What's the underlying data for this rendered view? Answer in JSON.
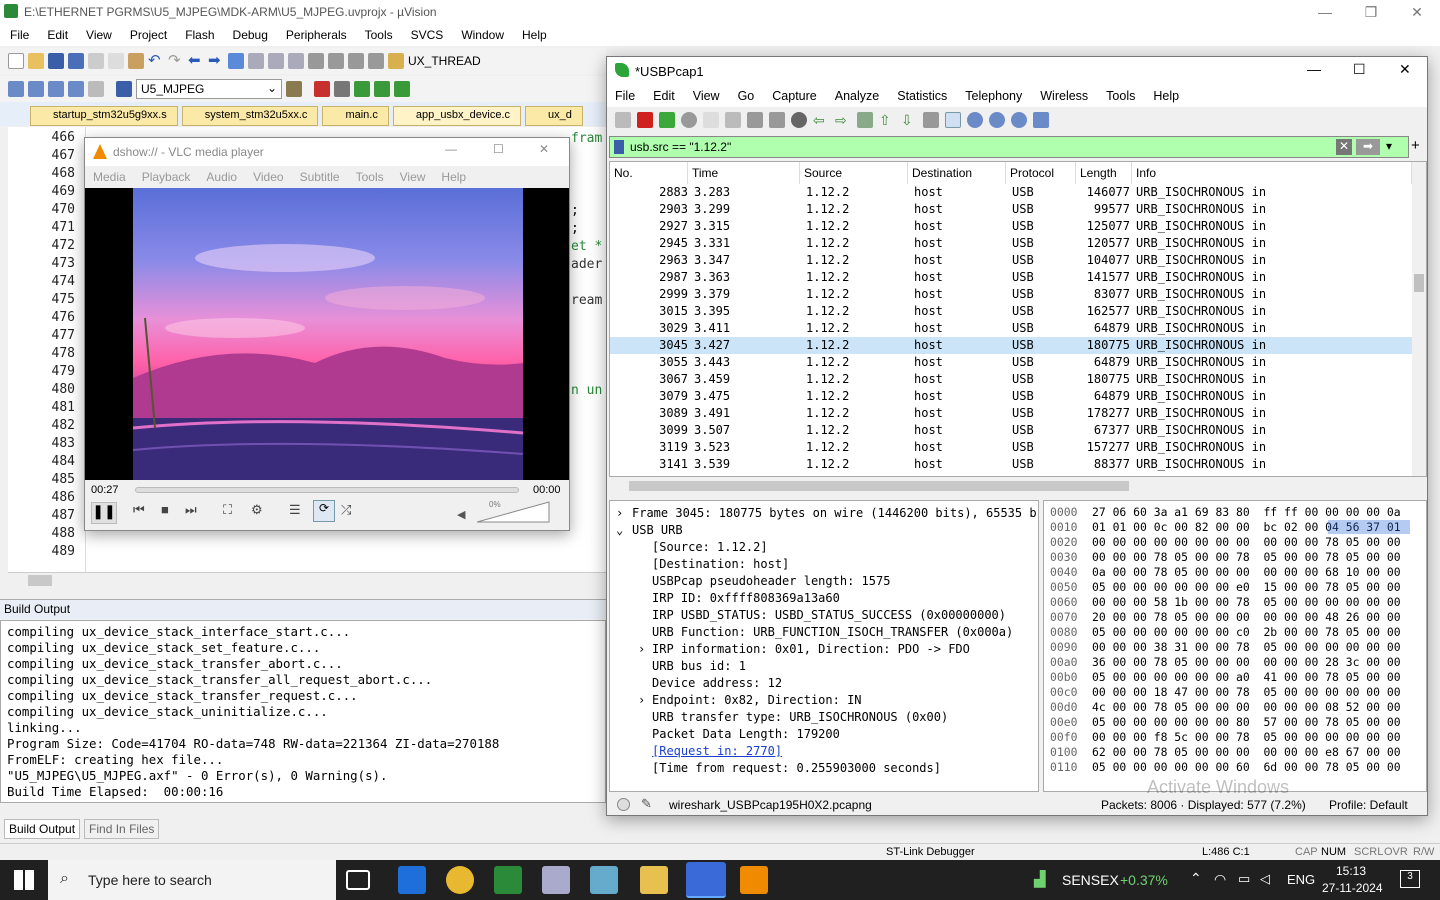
{
  "uvision": {
    "title": "E:\\ETHERNET PGRMS\\U5_MJPEG\\MDK-ARM\\U5_MJPEG.uvprojx - µVision",
    "menu": [
      "File",
      "Edit",
      "View",
      "Project",
      "Flash",
      "Debug",
      "Peripherals",
      "Tools",
      "SVCS",
      "Window",
      "Help"
    ],
    "thread_box": "UX_THREAD",
    "target": "U5_MJPEG",
    "tabs": [
      "startup_stm32u5g9xx.s",
      "system_stm32u5xx.c",
      "main.c",
      "app_usbx_device.c",
      "ux_d"
    ],
    "line_numbers": [
      "466",
      "467",
      "468",
      "469",
      "470",
      "471",
      "472",
      "473",
      "474",
      "475",
      "476",
      "477",
      "478",
      "479",
      "480",
      "481",
      "482",
      "483",
      "484",
      "485",
      "486",
      "487",
      "488",
      "489"
    ],
    "code_fragments": [
      "fram",
      ";",
      ";",
      "et *",
      "ader",
      "ream",
      "n un"
    ],
    "build_output_title": "Build Output",
    "build_lines": [
      "compiling ux_device_stack_interface_start.c...",
      "compiling ux_device_stack_set_feature.c...",
      "compiling ux_device_stack_transfer_abort.c...",
      "compiling ux_device_stack_transfer_all_request_abort.c...",
      "compiling ux_device_stack_transfer_request.c...",
      "compiling ux_device_stack_uninitialize.c...",
      "linking...",
      "Program Size: Code=41704 RO-data=748 RW-data=221364 ZI-data=270188",
      "FromELF: creating hex file...",
      "\"U5_MJPEG\\U5_MJPEG.axf\" - 0 Error(s), 0 Warning(s).",
      "Build Time Elapsed:  00:00:16"
    ],
    "bottom_tabs": [
      "Build Output",
      "Find In Files"
    ],
    "status": {
      "debugger": "ST-Link Debugger",
      "position": "L:486 C:1",
      "caps": "CAP",
      "num": "NUM",
      "scrl": "SCRL",
      "ovr": "OVR",
      "rw": "R/W"
    }
  },
  "vlc": {
    "title": "dshow:// - VLC media player",
    "menu": [
      "Media",
      "Playback",
      "Audio",
      "Video",
      "Subtitle",
      "Tools",
      "View",
      "Help"
    ],
    "elapsed": "00:27",
    "remaining": "00:00",
    "volume": "0%"
  },
  "wireshark": {
    "title": "*USBPcap1",
    "menu": [
      "File",
      "Edit",
      "View",
      "Go",
      "Capture",
      "Analyze",
      "Statistics",
      "Telephony",
      "Wireless",
      "Tools",
      "Help"
    ],
    "filter": "usb.src == \"1.12.2\"",
    "columns": [
      "No.",
      "Time",
      "Source",
      "Destination",
      "Protocol",
      "Length",
      "Info"
    ],
    "packets": [
      {
        "no": "2883",
        "time": "3.283",
        "src": "1.12.2",
        "dst": "host",
        "proto": "USB",
        "len": "146077",
        "info": "URB_ISOCHRONOUS in"
      },
      {
        "no": "2903",
        "time": "3.299",
        "src": "1.12.2",
        "dst": "host",
        "proto": "USB",
        "len": "99577",
        "info": "URB_ISOCHRONOUS in"
      },
      {
        "no": "2927",
        "time": "3.315",
        "src": "1.12.2",
        "dst": "host",
        "proto": "USB",
        "len": "125077",
        "info": "URB_ISOCHRONOUS in"
      },
      {
        "no": "2945",
        "time": "3.331",
        "src": "1.12.2",
        "dst": "host",
        "proto": "USB",
        "len": "120577",
        "info": "URB_ISOCHRONOUS in"
      },
      {
        "no": "2963",
        "time": "3.347",
        "src": "1.12.2",
        "dst": "host",
        "proto": "USB",
        "len": "104077",
        "info": "URB_ISOCHRONOUS in"
      },
      {
        "no": "2987",
        "time": "3.363",
        "src": "1.12.2",
        "dst": "host",
        "proto": "USB",
        "len": "141577",
        "info": "URB_ISOCHRONOUS in"
      },
      {
        "no": "2999",
        "time": "3.379",
        "src": "1.12.2",
        "dst": "host",
        "proto": "USB",
        "len": "83077",
        "info": "URB_ISOCHRONOUS in"
      },
      {
        "no": "3015",
        "time": "3.395",
        "src": "1.12.2",
        "dst": "host",
        "proto": "USB",
        "len": "162577",
        "info": "URB_ISOCHRONOUS in"
      },
      {
        "no": "3029",
        "time": "3.411",
        "src": "1.12.2",
        "dst": "host",
        "proto": "USB",
        "len": "64879",
        "info": "URB_ISOCHRONOUS in"
      },
      {
        "no": "3045",
        "time": "3.427",
        "src": "1.12.2",
        "dst": "host",
        "proto": "USB",
        "len": "180775",
        "info": "URB_ISOCHRONOUS in"
      },
      {
        "no": "3055",
        "time": "3.443",
        "src": "1.12.2",
        "dst": "host",
        "proto": "USB",
        "len": "64879",
        "info": "URB_ISOCHRONOUS in"
      },
      {
        "no": "3067",
        "time": "3.459",
        "src": "1.12.2",
        "dst": "host",
        "proto": "USB",
        "len": "180775",
        "info": "URB_ISOCHRONOUS in"
      },
      {
        "no": "3079",
        "time": "3.475",
        "src": "1.12.2",
        "dst": "host",
        "proto": "USB",
        "len": "64879",
        "info": "URB_ISOCHRONOUS in"
      },
      {
        "no": "3089",
        "time": "3.491",
        "src": "1.12.2",
        "dst": "host",
        "proto": "USB",
        "len": "178277",
        "info": "URB_ISOCHRONOUS in"
      },
      {
        "no": "3099",
        "time": "3.507",
        "src": "1.12.2",
        "dst": "host",
        "proto": "USB",
        "len": "67377",
        "info": "URB_ISOCHRONOUS in"
      },
      {
        "no": "3119",
        "time": "3.523",
        "src": "1.12.2",
        "dst": "host",
        "proto": "USB",
        "len": "157277",
        "info": "URB_ISOCHRONOUS in"
      },
      {
        "no": "3141",
        "time": "3.539",
        "src": "1.12.2",
        "dst": "host",
        "proto": "USB",
        "len": "88377",
        "info": "URB_ISOCHRONOUS in"
      }
    ],
    "selected_no": "3045",
    "details": [
      "Frame 3045: 180775 bytes on wire (1446200 bits), 65535 b",
      "USB URB",
      "[Source: 1.12.2]",
      "[Destination: host]",
      "USBPcap pseudoheader length: 1575",
      "IRP ID: 0xffff808369a13a60",
      "IRP USBD_STATUS: USBD_STATUS_SUCCESS (0x00000000)",
      "URB Function: URB_FUNCTION_ISOCH_TRANSFER (0x000a)",
      "IRP information: 0x01, Direction: PDO -> FDO",
      "URB bus id: 1",
      "Device address: 12",
      "Endpoint: 0x82, Direction: IN",
      "URB transfer type: URB_ISOCHRONOUS (0x00)",
      "Packet Data Length: 179200",
      "[Request in: 2770]",
      "[Time from request: 0.255903000 seconds]"
    ],
    "hex_offsets": [
      "0000",
      "0010",
      "0020",
      "0030",
      "0040",
      "0050",
      "0060",
      "0070",
      "0080",
      "0090",
      "00a0",
      "00b0",
      "00c0",
      "00d0",
      "00e0",
      "00f0",
      "0100",
      "0110"
    ],
    "hex_rows": [
      "27 06 60 3a a1 69 83 80  ff ff 00 00 00 00 0a",
      "01 01 00 0c 00 82 00 00  bc 02 00 04 56 37 01",
      "00 00 00 00 00 00 00 00  00 00 00 78 05 00 00",
      "00 00 00 78 05 00 00 78  05 00 00 78 05 00 00",
      "0a 00 00 78 05 00 00 00  00 00 00 68 10 00 00",
      "05 00 00 00 00 00 00 e0  15 00 00 78 05 00 00",
      "00 00 00 58 1b 00 00 78  05 00 00 00 00 00 00",
      "20 00 00 78 05 00 00 00  00 00 00 48 26 00 00",
      "05 00 00 00 00 00 00 c0  2b 00 00 78 05 00 00",
      "00 00 00 38 31 00 00 78  05 00 00 00 00 00 00",
      "36 00 00 78 05 00 00 00  00 00 00 28 3c 00 00",
      "05 00 00 00 00 00 00 a0  41 00 00 78 05 00 00",
      "00 00 00 18 47 00 00 78  05 00 00 00 00 00 00",
      "4c 00 00 78 05 00 00 00  00 00 00 08 52 00 00",
      "05 00 00 00 00 00 00 80  57 00 00 78 05 00 00",
      "00 00 00 f8 5c 00 00 78  05 00 00 00 00 00 00",
      "62 00 00 78 05 00 00 00  00 00 00 e8 67 00 00",
      "05 00 00 00 00 00 00 60  6d 00 00 78 05 00 00"
    ],
    "file": "wireshark_USBPcap195H0X2.pcapng",
    "packets_info": "Packets: 8006 · Displayed: 577 (7.2%)",
    "profile": "Profile: Default",
    "watermark": "Activate Windows"
  },
  "taskbar": {
    "search_placeholder": "Type here to search",
    "sensex": "SENSEX",
    "sensex_change": "+0.37%",
    "lang": "ENG",
    "time": "15:13",
    "date": "27-11-2024",
    "notifications": "3"
  },
  "colors": {
    "accent": "#0078d7",
    "filter_bg": "#afffaf",
    "selected_row": "#cce4f7",
    "taskbar": "#202020",
    "sensex_green": "#6fd26f"
  }
}
